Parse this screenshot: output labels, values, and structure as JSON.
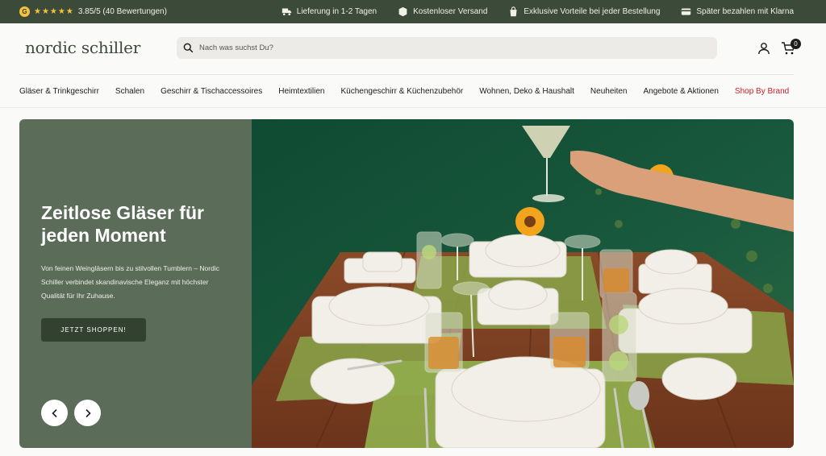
{
  "topbar": {
    "rating_logo": "G",
    "stars": "★★★★★",
    "rating_text": "3.85/5 (40 Bewertungen)",
    "usps": [
      {
        "icon": "truck-icon",
        "label": "Lieferung in 1-2 Tagen"
      },
      {
        "icon": "box-icon",
        "label": "Kostenloser Versand"
      },
      {
        "icon": "bag-icon",
        "label": "Exklusive Vorteile bei jeder Bestellung"
      },
      {
        "icon": "card-icon",
        "label": "Später bezahlen mit Klarna"
      }
    ]
  },
  "header": {
    "logo": "nordic schiller",
    "search_placeholder": "Nach was suchst Du?",
    "cart_count": "0"
  },
  "nav": {
    "items": [
      "Gläser & Trinkgeschirr",
      "Schalen",
      "Geschirr & Tischaccessoires",
      "Heimtextilien",
      "Küchengeschirr & Küchenzubehör",
      "Wohnen, Deko & Haushalt",
      "Neuheiten",
      "Angebote & Aktionen",
      "Shop By Brand"
    ]
  },
  "hero": {
    "title": "Zeitlose Gläser für jeden Moment",
    "text": "Von feinen Weingläsern bis zu stilvollen Tumblern – Nordic Schiller verbindet skandinavische Eleganz mit höchster Qualität für Ihr Zuhause.",
    "button": "JETZT SHOPPEN!"
  },
  "colors": {
    "topbar_bg": "#3c4a3a",
    "hero_panel": "#5b6d59",
    "button_bg": "#334230",
    "brand_link": "#c9202a",
    "star": "#f6c23b"
  }
}
